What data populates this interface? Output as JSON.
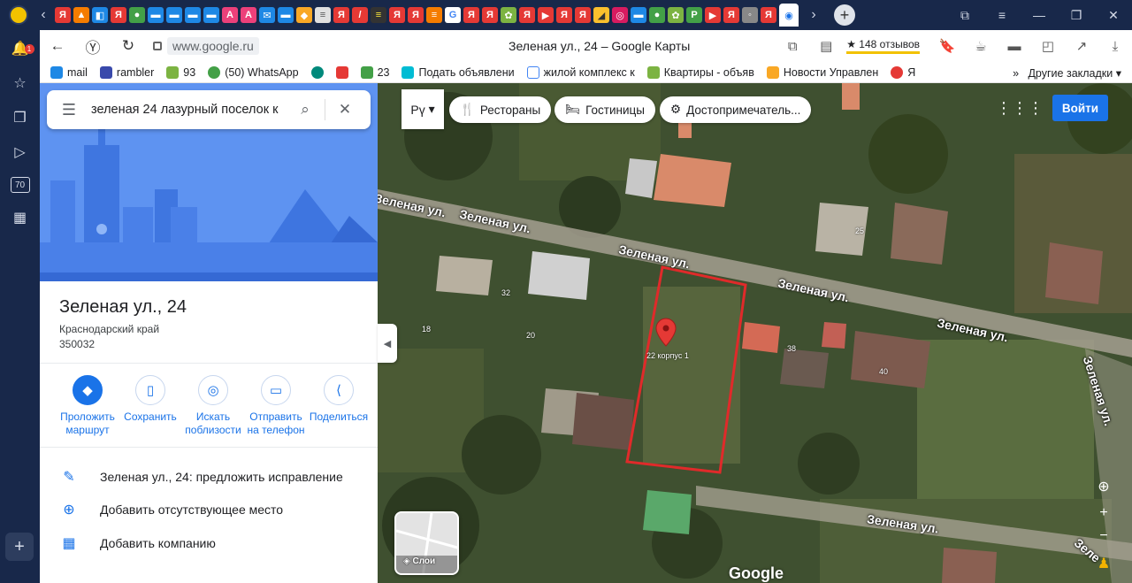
{
  "browser": {
    "url": "www.google.ru",
    "page_title": "Зеленая ул., 24 – Google Карты",
    "reviews": "★ 148 отзывов",
    "bookmarks": [
      "mail",
      "rambler",
      "93",
      "(50) WhatsApp",
      "23",
      "Подать объявлени",
      "жилой комплекс к",
      "Квартиры - объяв",
      "Новости Управлен",
      "Я"
    ],
    "other_bookmarks": "Другие закладки",
    "sidebar_counter": "70",
    "notification_count": "1"
  },
  "search": {
    "query": "зеленая 24 лазурный поселок к"
  },
  "place": {
    "title": "Зеленая ул., 24",
    "region": "Краснодарский край",
    "zip": "350032"
  },
  "actions": [
    {
      "label": "Проложить маршрут"
    },
    {
      "label": "Сохранить"
    },
    {
      "label": "Искать поблизости"
    },
    {
      "label": "Отправить на телефон"
    },
    {
      "label": "Поделиться"
    }
  ],
  "list": [
    {
      "label": "Зеленая ул., 24: предложить исправление"
    },
    {
      "label": "Добавить отсутствующее место"
    },
    {
      "label": "Добавить компанию"
    }
  ],
  "map": {
    "language": "Рү",
    "chips": [
      "Рестораны",
      "Гостиницы",
      "Достопримечатель..."
    ],
    "login": "Войти",
    "layers": "Слои",
    "brand": "Google",
    "pin_label": "22 корпус 1",
    "streets": [
      "Зеленая ул.",
      "Зеленая ул.",
      "Зеленая ул.",
      "Зеленая ул.",
      "Зеленая ул.",
      "Зеленая ул.",
      "Зеленая ул.",
      "Зеле"
    ],
    "house_numbers": [
      "32",
      "18",
      "20",
      "25",
      "38",
      "40"
    ]
  }
}
